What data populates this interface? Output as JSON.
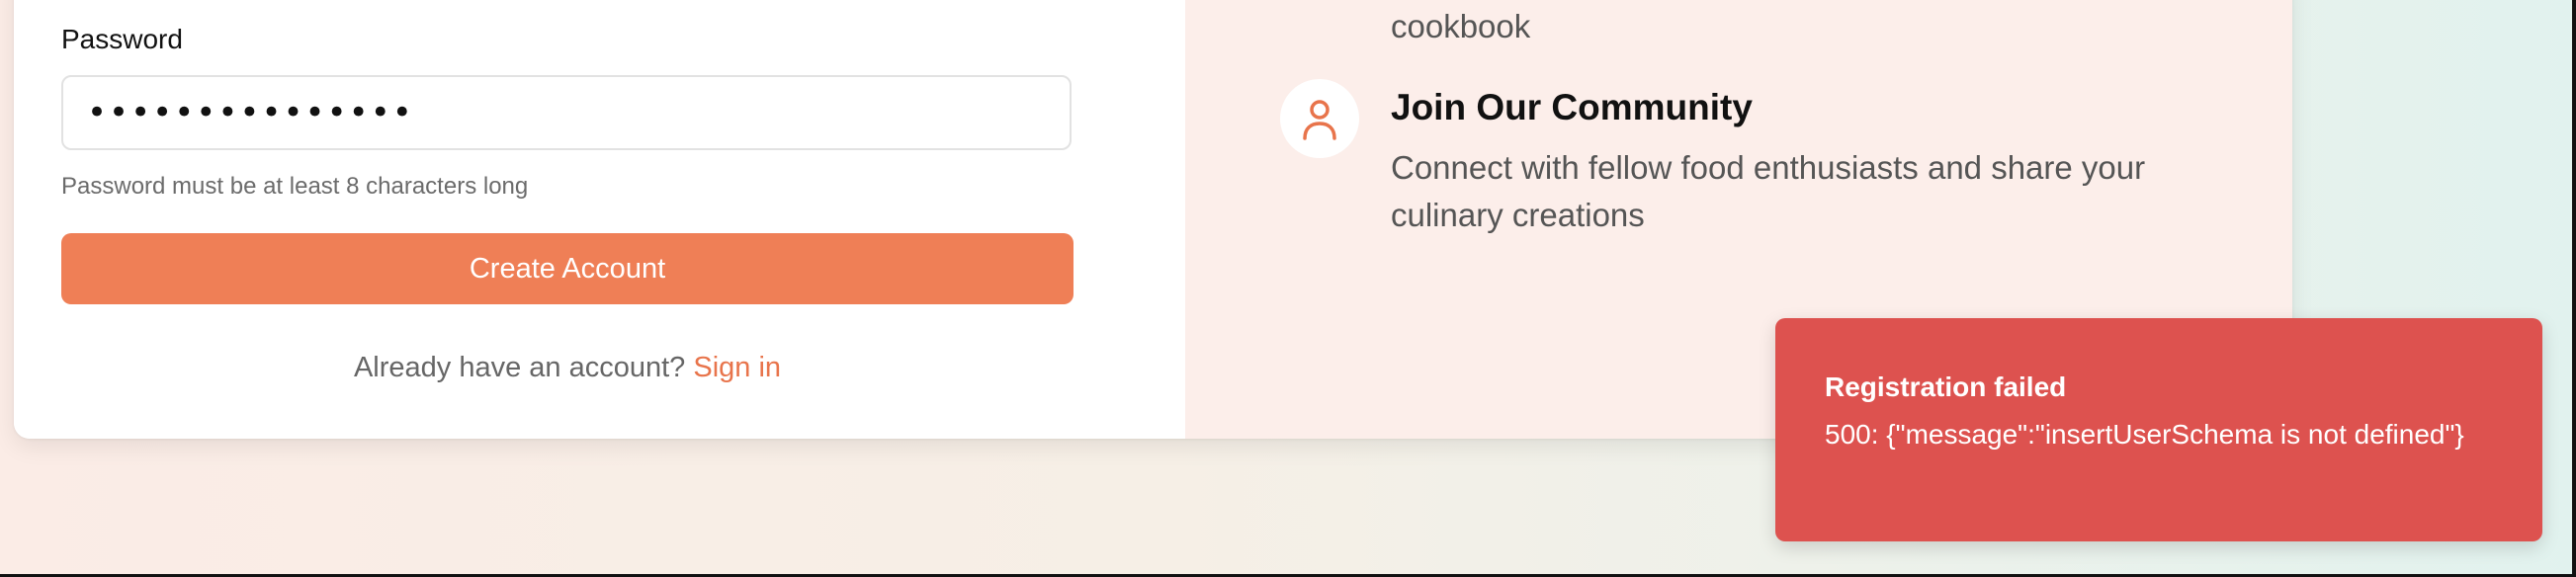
{
  "form": {
    "password_label": "Password",
    "password_value": "•••••••••••••••",
    "password_hint": "Password must be at least 8 characters long",
    "create_button_label": "Create Account",
    "signin_prompt": "Already have an account?",
    "signin_link": "Sign in"
  },
  "features": {
    "previous_desc_tail": "cookbook",
    "community": {
      "icon": "user-icon",
      "title": "Join Our Community",
      "description": "Connect with fellow food enthusiasts and share your culinary creations"
    }
  },
  "toast": {
    "title": "Registration failed",
    "message": "500: {\"message\":\"insertUserSchema is not defined\"}"
  },
  "colors": {
    "accent": "#ef7f56",
    "link": "#e8744b",
    "error": "#dd524f",
    "panel": "#fceeea"
  }
}
